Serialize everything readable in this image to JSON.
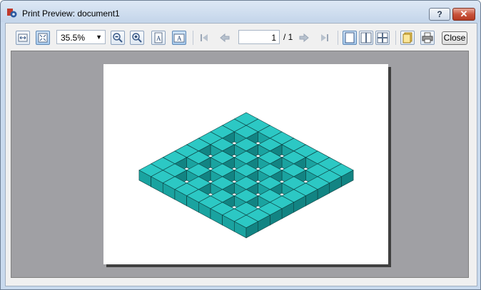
{
  "window": {
    "title": "Print Preview: document1"
  },
  "titlebar": {
    "help_label": "?",
    "close_label": "✕"
  },
  "toolbar": {
    "zoom_value": "35.5%",
    "current_page": "1",
    "page_total": "/ 1",
    "close_label": "Close",
    "icons": [
      "fit-width-icon",
      "fit-page-icon",
      "zoom-out-icon",
      "zoom-in-icon",
      "portrait-icon",
      "landscape-icon",
      "first-page-icon",
      "previous-page-icon",
      "next-page-icon",
      "last-page-icon",
      "single-page-icon",
      "facing-pages-icon",
      "overview-icon",
      "page-setup-icon",
      "print-icon"
    ]
  },
  "preview": {
    "content": "3D isometric grid of teal cubes",
    "cube_color": "#1fb5b2"
  }
}
